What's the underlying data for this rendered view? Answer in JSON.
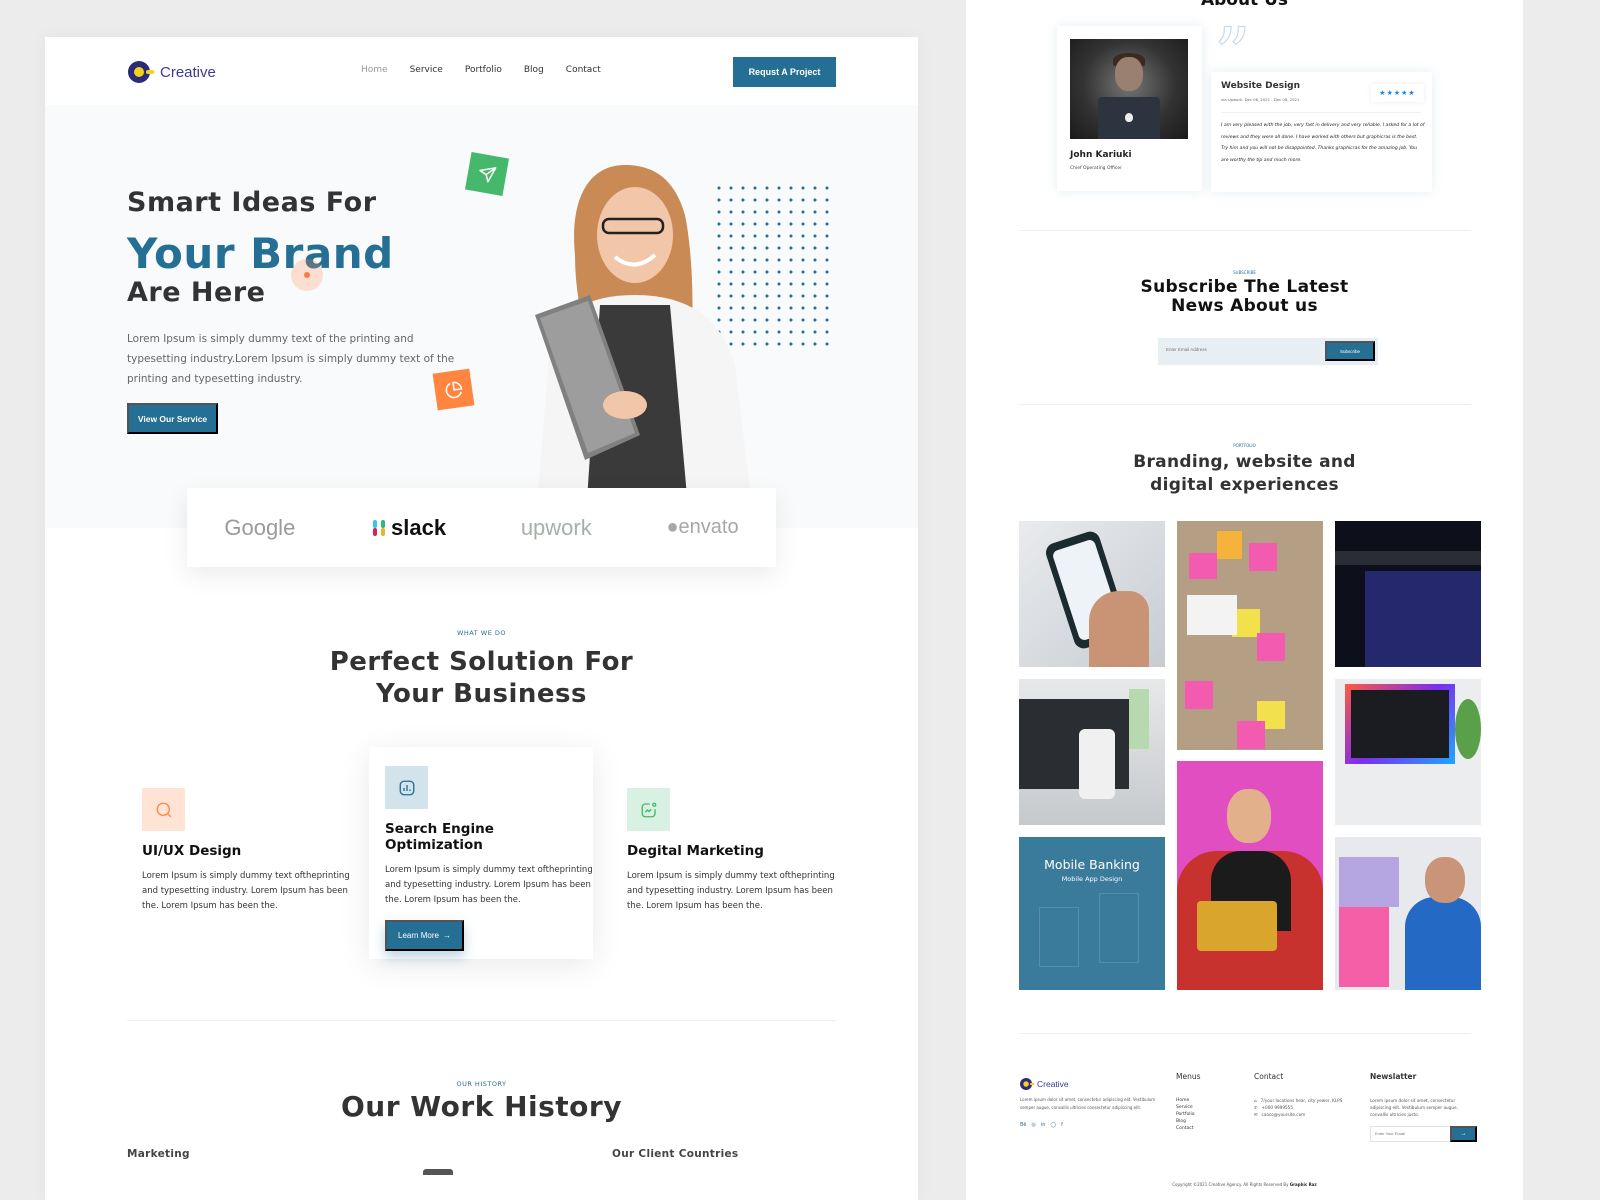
{
  "colors": {
    "primary": "#256f94",
    "accent_orange": "#ff8540",
    "accent_green": "#45b86b",
    "logo_navy": "#2e2a7a",
    "logo_yellow": "#f4d21a",
    "star_blue": "#1e88e5"
  },
  "header": {
    "logo_text": "Creative",
    "nav": [
      "Home",
      "Service",
      "Portfolio",
      "Blog",
      "Contact"
    ],
    "active_nav": "Home",
    "cta_label": "Requst A Project"
  },
  "hero": {
    "line1": "Smart Ideas For",
    "line2": "Your Brand",
    "line3": "Are Here",
    "paragraph": "Lorem Ipsum is simply dummy text of the printing and typesetting industry.Lorem Ipsum is simply dummy text of the printing and typesetting industry.",
    "button_label": "View Our Service",
    "float_icons": [
      "send-icon",
      "pie-chart-icon"
    ]
  },
  "brands": [
    "Google",
    "slack",
    "upwork",
    "envato"
  ],
  "what_we_do": {
    "eyebrow": "WHAT WE DO",
    "title_line1": "Perfect Solution For",
    "title_line2": "Your Business",
    "services": [
      {
        "icon": "search-icon",
        "title": "UI/UX Design",
        "text": "Lorem Ipsum is simply dummy text oftheprinting and typesetting industry. Lorem Ipsum has been the.  Lorem Ipsum has been the."
      },
      {
        "icon": "chart-icon",
        "title": "Search Engine Optimization",
        "text": "Lorem Ipsum is simply dummy text oftheprinting and typesetting industry. Lorem Ipsum has been the.  Lorem Ipsum has been the.",
        "button_label": "Learn More",
        "button_arrow": "→"
      },
      {
        "icon": "trend-icon",
        "title": "Degital Marketing",
        "text": "Lorem Ipsum is simply dummy text oftheprinting and typesetting industry. Lorem Ipsum has been the.  Lorem Ipsum has been the."
      }
    ]
  },
  "history": {
    "eyebrow": "OUR HISTORY",
    "title": "Our Work History",
    "left_label": "Marketing",
    "right_label": "Our Client Countries"
  },
  "about": {
    "title": "About Us",
    "member": {
      "name": "John Kariuki",
      "role": "Chief Operating Officer"
    },
    "review": {
      "title": "Website Design",
      "meta": "via Upwork. Dec 06, 2021 - Dec 08, 2021",
      "rating": 5,
      "stars": "★★★★★",
      "text": "I am very pleased with the job, very fast in delivery and very reliable. I asked for a lot of reviews and they were all done. I have worked with others but graphicras is the best. Try him and you will not be disappointed. Thanks graphicras for the amazing job. You are worthy the tip and much more."
    }
  },
  "subscribe": {
    "eyebrow": "SUBSCRIBE",
    "title_line1": "Subscribe The Latest",
    "title_line2": "News About us",
    "placeholder": "Enter Email Address",
    "button_label": "Subscribe"
  },
  "portfolio": {
    "eyebrow": "PORTFOLIO",
    "title_line1": "Branding, website and",
    "title_line2": "digital experiences",
    "tiles": [
      {
        "name": "weather-app-phone"
      },
      {
        "name": "sticky-notes-board"
      },
      {
        "name": "crypto-dashboard"
      },
      {
        "name": "mobile-app-laptop"
      },
      {
        "name": "woman-with-laptop"
      },
      {
        "name": "desktop-dashboard"
      },
      {
        "name": "mobile-banking",
        "title": "Mobile Banking",
        "subtitle": "Mobile App Design"
      },
      {
        "name": "sticky-notes-team"
      }
    ]
  },
  "footer": {
    "logo_text": "Creative",
    "about": "Lorem ipsum dolor sit amet, consectetur adipiscing elit. Vestibulum semper augue, convallis ultricies consectetur adipiscing elit.",
    "social": [
      "Bē",
      "◎",
      "in",
      "◯",
      "f"
    ],
    "menus_title": "Menus",
    "menus": [
      "Home",
      "Service",
      "Portfolio",
      "Blog",
      "Contact"
    ],
    "contact_title": "Contact",
    "contact": [
      {
        "icon": "⌂",
        "text": "7/your locations hear, city yewer, KLPS"
      },
      {
        "icon": "✆",
        "text": "+000 9999555"
      },
      {
        "icon": "✉",
        "text": "caoco@yoursite.com"
      }
    ],
    "newsletter_title": "Newslatter",
    "newsletter_text": "Lorem ipsum dolor sit amet, consectetur adipiscing elit. Vestibulum semper augue, convallis ultricies justo.",
    "newsletter_placeholder": "Enter Your Email",
    "newsletter_btn": "→",
    "copyright": "Copyright ©2021 Creative Agency. All Rights Reserved By",
    "copyright_brand": "Graphic Raz"
  }
}
